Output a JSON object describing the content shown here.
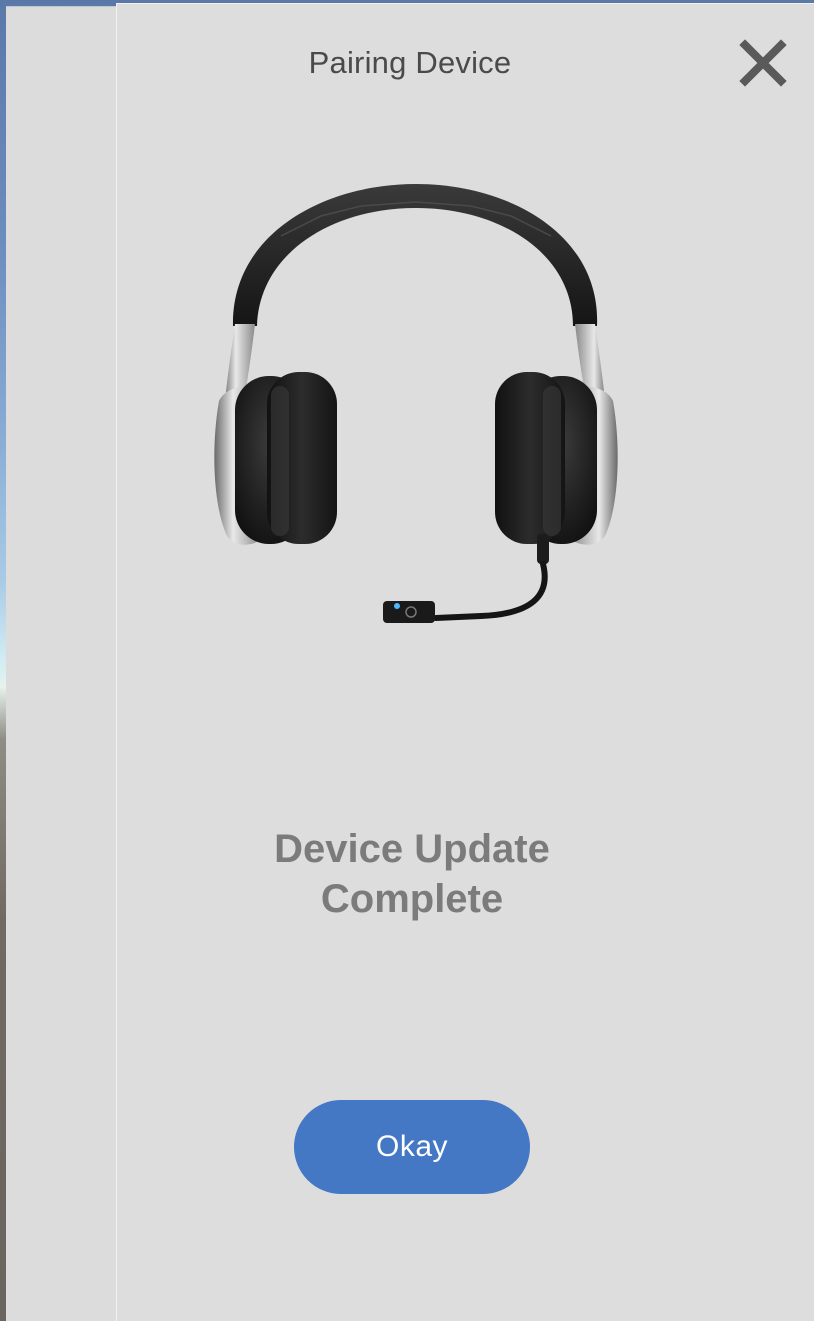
{
  "dialog": {
    "title": "Pairing Device",
    "message_line1": "Device Update",
    "message_line2": "Complete",
    "okay_label": "Okay"
  },
  "icons": {
    "close": "close-icon",
    "product": "headset-icon"
  },
  "colors": {
    "dialog_background": "#dddddd",
    "title_text": "#4a4a4a",
    "message_text": "#7b7b7b",
    "button_background": "#4477c4",
    "button_text": "#ffffff",
    "close_icon": "#5a5a5a"
  }
}
